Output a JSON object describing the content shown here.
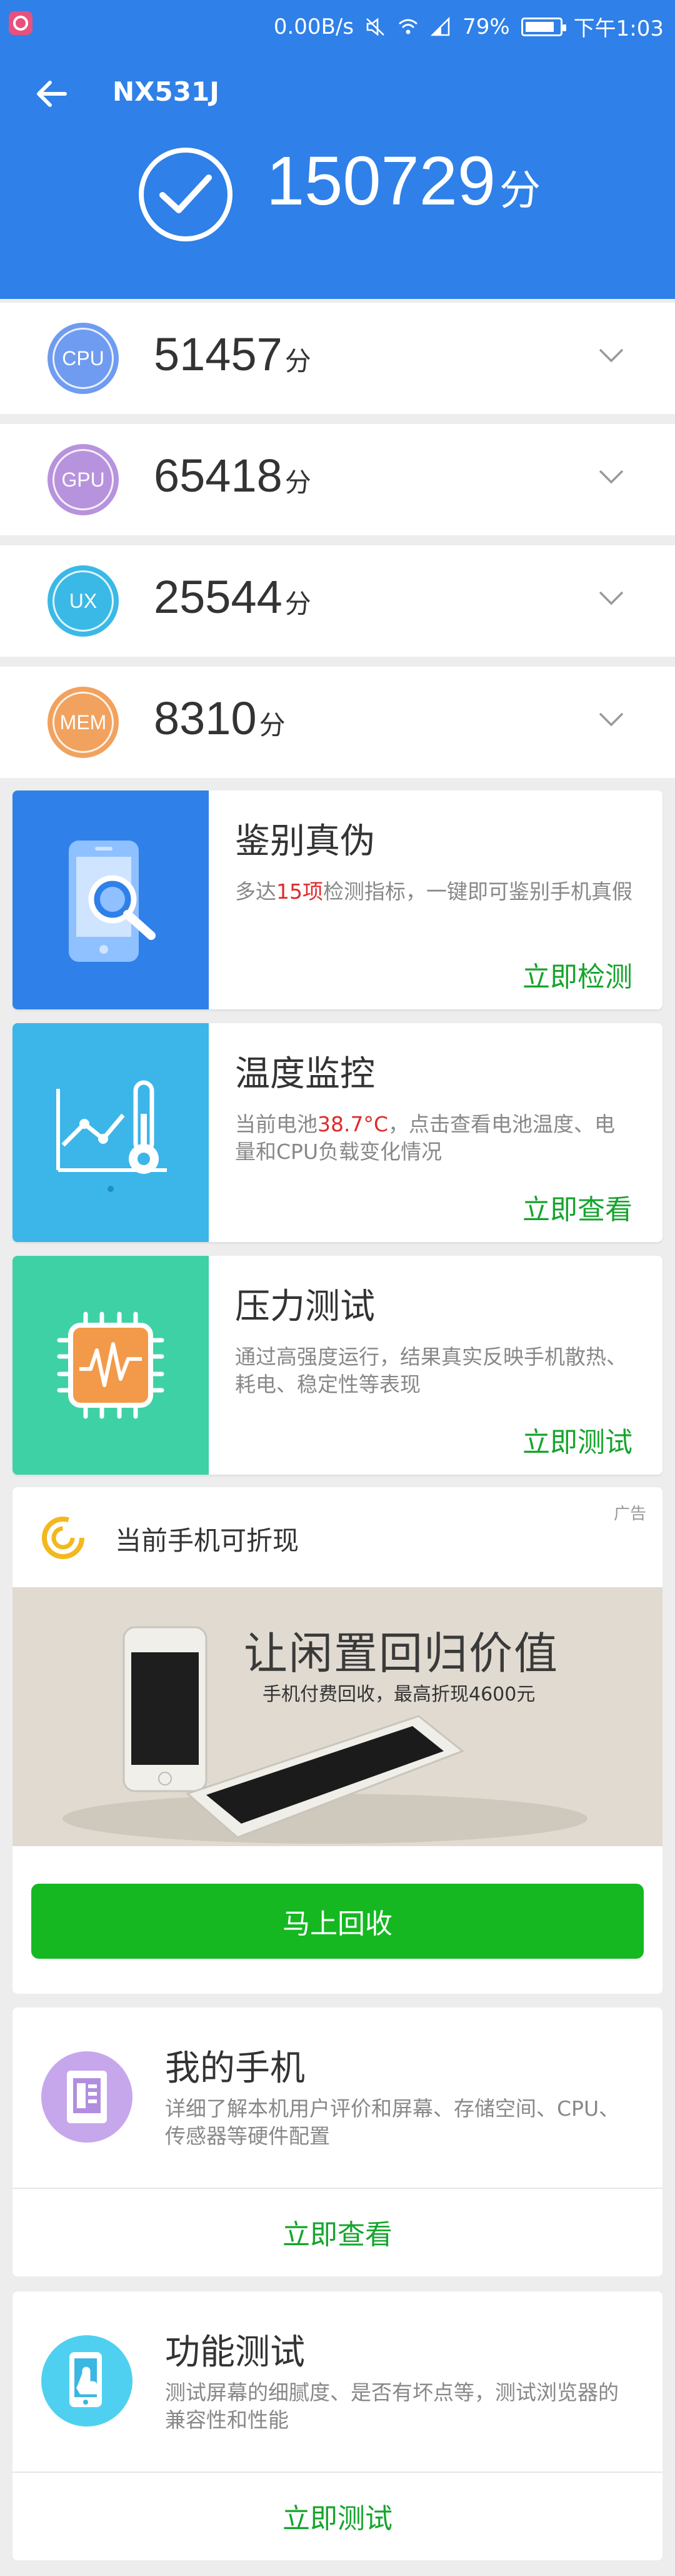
{
  "status_bar": {
    "network_speed": "0.00B/s",
    "battery_percent": "79%",
    "battery_level": 0.79,
    "time": "下午1:03"
  },
  "header": {
    "device": "NX531J",
    "total_score": "150729",
    "score_unit": "分",
    "color": "#2f80e8"
  },
  "scores": [
    {
      "key": "cpu",
      "label": "CPU",
      "value": "51457",
      "unit": "分",
      "color": "#6f9cf0"
    },
    {
      "key": "gpu",
      "label": "GPU",
      "value": "65418",
      "unit": "分",
      "color": "#b793dd"
    },
    {
      "key": "ux",
      "label": "UX",
      "value": "25544",
      "unit": "分",
      "color": "#3bb9e6"
    },
    {
      "key": "mem",
      "label": "MEM",
      "value": "8310",
      "unit": "分",
      "color": "#f1a25e"
    }
  ],
  "features": [
    {
      "key": "verify",
      "title": "鉴别真伪",
      "desc_pre": "多达",
      "desc_highlight": "15项",
      "desc_post": "检测指标，一键即可鉴别手机真假",
      "action": "立即检测",
      "color": "#2f80e8"
    },
    {
      "key": "temperature",
      "title": "温度监控",
      "desc_pre": "当前电池",
      "desc_highlight": "38.7°C",
      "desc_post": "，点击查看电池温度、电量和CPU负载变化情况",
      "action": "立即查看",
      "color": "#3cb6e8"
    },
    {
      "key": "stress",
      "title": "压力测试",
      "desc_pre": "通过高强度运行，结果真实反映手机散热、耗电、稳定性等表现",
      "desc_highlight": "",
      "desc_post": "",
      "action": "立即测试",
      "color": "#3fd1a6"
    }
  ],
  "ad": {
    "label": "广告",
    "title": "当前手机可折现",
    "headline": "让闲置回归价值",
    "subline": "手机付费回收，最高折现4600元",
    "button": "马上回收",
    "button_color": "#15b821"
  },
  "info_cards": [
    {
      "key": "my_phone",
      "title": "我的手机",
      "desc": "详细了解本机用户评价和屏幕、存储空间、CPU、传感器等硬件配置",
      "action": "立即查看",
      "color": "#c7a7ec"
    },
    {
      "key": "function_test",
      "title": "功能测试",
      "desc": "测试屏幕的细腻度、是否有坏点等，测试浏览器的兼容性和性能",
      "action": "立即测试",
      "color": "#4fd0f0"
    }
  ],
  "colors": {
    "accent_green": "#16a42d",
    "highlight_red": "#e02a2a",
    "background": "#ededed"
  }
}
